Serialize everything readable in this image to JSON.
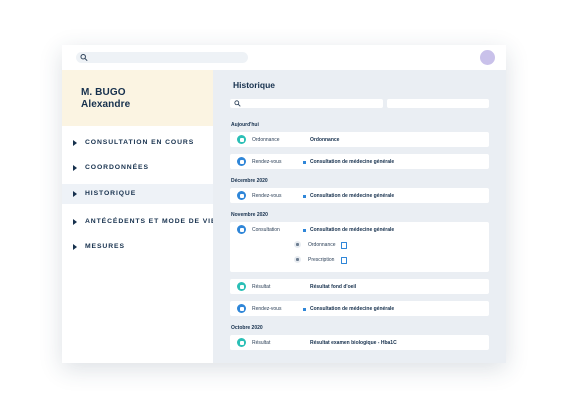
{
  "top": {
    "search_icon": "search-icon",
    "avatar_color": "#c9c1ea"
  },
  "patient": {
    "line1": "M. BUGO",
    "line2": "Alexandre"
  },
  "sidebar": {
    "items": [
      {
        "label": "CONSULTATION EN COURS",
        "active": false
      },
      {
        "label": "COORDONNÉES",
        "active": false
      },
      {
        "label": "HISTORIQUE",
        "active": true
      },
      {
        "label": "ANTÉCÉDENTS ET MODE DE VIE",
        "active": false
      },
      {
        "label": "MESURES",
        "active": false
      }
    ]
  },
  "main": {
    "title": "Historique",
    "sections": [
      {
        "label": "Aujourd'hui",
        "entries": [
          {
            "type": "Ordonnance",
            "desc": "Ordonnance",
            "icon": "prescription-icon",
            "color": "#2bbfb6",
            "dot": false
          },
          {
            "type": "Rendez-vous",
            "desc": "Consultation de médecine générale",
            "icon": "calendar-icon",
            "color": "#2f86d8",
            "dot": true
          }
        ]
      },
      {
        "label": "Décembre 2020",
        "entries": [
          {
            "type": "Rendez-vous",
            "desc": "Consultation de médecine générale",
            "icon": "calendar-icon",
            "color": "#2f86d8",
            "dot": true
          }
        ]
      },
      {
        "label": "Novembre 2020",
        "entries": [
          {
            "type": "Consultation",
            "desc": "Consultation de médecine générale",
            "icon": "stethoscope-icon",
            "color": "#2f86d8",
            "dot": true,
            "sub": [
              {
                "label": "Ordonnance",
                "icon": "pill-icon"
              },
              {
                "label": "Prescription",
                "icon": "prescription-icon"
              }
            ]
          },
          {
            "type": "Résultat",
            "desc": "Résultat fond d'oeil",
            "icon": "lab-result-icon",
            "color": "#2bbfb6",
            "dot": false
          },
          {
            "type": "Rendez-vous",
            "desc": "Consultation de médecine générale",
            "icon": "calendar-icon",
            "color": "#2f86d8",
            "dot": true
          }
        ]
      },
      {
        "label": "Octobre 2020",
        "entries": [
          {
            "type": "Résultat",
            "desc": "Résultat examen biologique - Hba1C",
            "icon": "lab-result-icon",
            "color": "#2bbfb6",
            "dot": false
          }
        ]
      }
    ]
  }
}
